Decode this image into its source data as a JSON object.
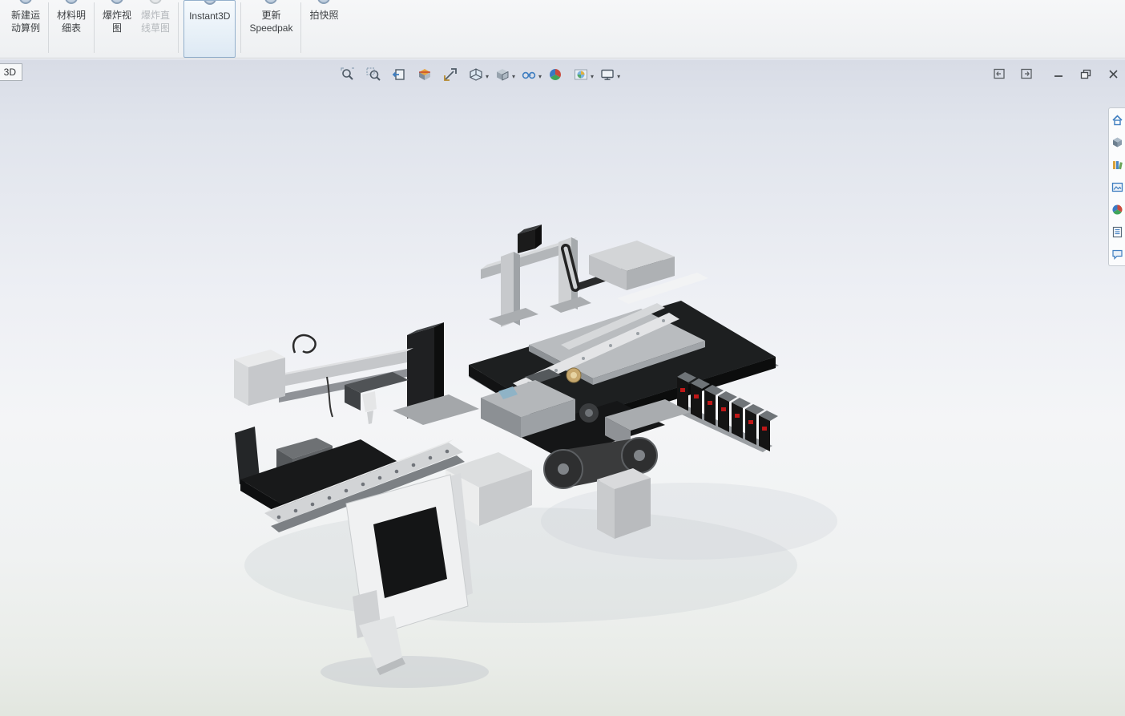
{
  "ribbon": {
    "buttons": [
      {
        "id": "new-motion-study",
        "line1": "新建运",
        "line2": "动算例",
        "enabled": true,
        "active": false
      },
      {
        "id": "bill-of-materials",
        "line1": "材料明",
        "line2": "细表",
        "enabled": true,
        "active": false
      },
      {
        "id": "exploded-view",
        "line1": "爆炸视",
        "line2": "图",
        "enabled": true,
        "active": false
      },
      {
        "id": "explode-line-sketch",
        "line1": "爆炸直",
        "line2": "线草图",
        "enabled": false,
        "active": false
      },
      {
        "id": "instant3d",
        "line1": "Instant3D",
        "line2": "",
        "enabled": true,
        "active": true
      },
      {
        "id": "update-speedpak",
        "line1": "更新",
        "line2": "Speedpak",
        "enabled": true,
        "active": false
      },
      {
        "id": "take-snapshot",
        "line1": "拍快照",
        "line2": "",
        "enabled": true,
        "active": false
      }
    ]
  },
  "document_tab": {
    "label": "3D"
  },
  "heads_up_toolbar": {
    "icons": [
      {
        "name": "zoom-to-fit-icon",
        "has_dropdown": false
      },
      {
        "name": "zoom-to-area-icon",
        "has_dropdown": false
      },
      {
        "name": "previous-view-icon",
        "has_dropdown": false
      },
      {
        "name": "section-view-icon",
        "has_dropdown": false
      },
      {
        "name": "measure-icon",
        "has_dropdown": false
      },
      {
        "name": "view-orientation-icon",
        "has_dropdown": true
      },
      {
        "name": "display-style-icon",
        "has_dropdown": true
      },
      {
        "name": "hide-show-items-icon",
        "has_dropdown": true
      },
      {
        "name": "edit-appearance-icon",
        "has_dropdown": false
      },
      {
        "name": "apply-scene-icon",
        "has_dropdown": true
      },
      {
        "name": "view-settings-icon",
        "has_dropdown": true
      }
    ]
  },
  "window_controls": {
    "icons": [
      "pane-previous-icon",
      "pane-next-icon",
      "minimize-icon",
      "restore-window-icon",
      "close-icon"
    ]
  },
  "task_pane": {
    "icons": [
      "home-icon",
      "solidworks-resources-icon",
      "design-library-icon",
      "view-palette-icon",
      "appearances-icon",
      "custom-properties-icon",
      "solidworks-forum-icon"
    ]
  },
  "viewport": {
    "colors": {
      "background_top": "#d8dce6",
      "background_bottom": "#e2e6df",
      "active_button_border": "#93b0cc",
      "model_black": "#1d1f20",
      "model_gray": "#b4b7ba",
      "model_light": "#eceded",
      "valve_red": "#c01818",
      "gold_accent": "#c7a86f",
      "blue_accent": "#8fb3c6"
    }
  }
}
